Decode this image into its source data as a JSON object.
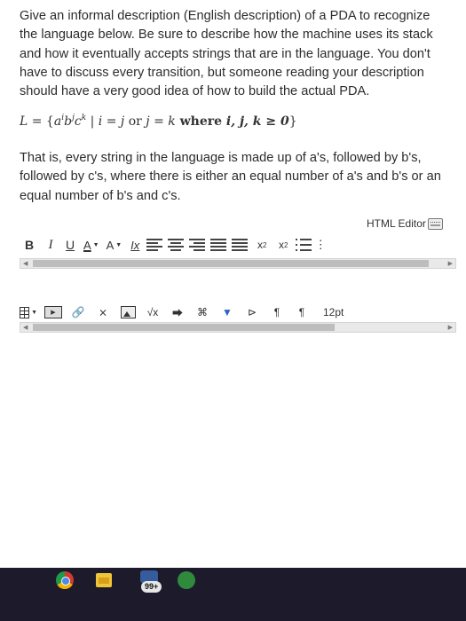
{
  "question": {
    "lines": [
      "Give an informal description (English description) of a PDA to recognize",
      "the language below. Be sure to describe how the machine uses its stack",
      "and how it eventually accepts strings that are in the language. You don't",
      "have to discuss every transition, but someone reading your description",
      "should have a very good idea of how to build the actual PDA."
    ]
  },
  "formula": {
    "lhs": "L",
    "eq": " = {",
    "a": "a",
    "i": "i",
    "b": "b",
    "j": "j",
    "c": "c",
    "k": "k",
    "mid": " | ",
    "cond1": "i = j",
    "or": " or ",
    "cond2": "j = k",
    "where": " where ",
    "vars": "i, j, k ≥ 0",
    "close": "}"
  },
  "explanation": {
    "lines": [
      "That is, every string in the language is made up of a's, followed by b's,",
      "followed by c's, where there is either an equal number of a's and b's or an",
      "equal number of b's and c's."
    ]
  },
  "editor": {
    "html_editor_label": "HTML Editor",
    "toolbar1": {
      "bold": "B",
      "italic": "I",
      "underline": "U",
      "font_color": "A",
      "highlight": "A",
      "clear_format": "Ix",
      "superscript": "x",
      "superscript_mark": "2",
      "subscript": "x",
      "subscript_mark": "2",
      "more": "⋮"
    },
    "toolbar2": {
      "sqrt": "√x",
      "ltr": "¶",
      "rtl": "¶",
      "font_size": "12pt"
    }
  },
  "taskbar": {
    "notification_count": "99+"
  },
  "colors": {
    "taskbar_bg": "#1d1b2b",
    "toolbar_text": "#333333"
  }
}
